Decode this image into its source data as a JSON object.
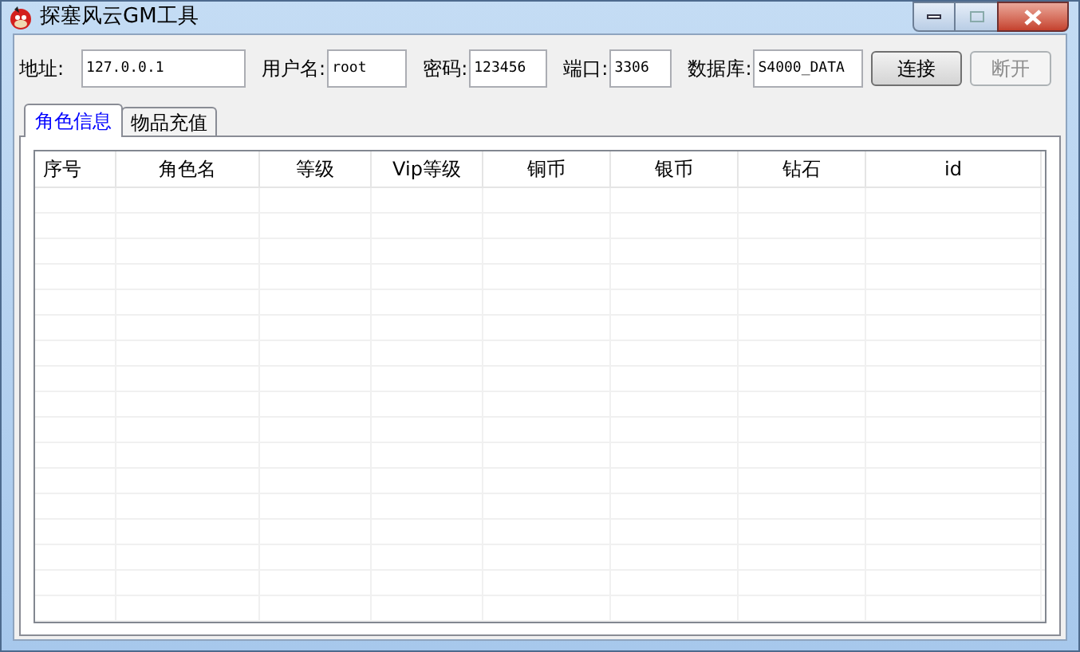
{
  "window": {
    "title": "探塞风云GM工具"
  },
  "connection": {
    "fields": [
      {
        "label": "地址:",
        "value": "127.0.0.1"
      },
      {
        "label": "用户名:",
        "value": "root"
      },
      {
        "label": "密码:",
        "value": "123456"
      },
      {
        "label": "端口:",
        "value": "3306"
      },
      {
        "label": "数据库:",
        "value": "S4000_DATA"
      }
    ],
    "buttons": [
      {
        "label": "连接",
        "disabled": false
      },
      {
        "label": "断开",
        "disabled": true
      }
    ]
  },
  "tabs": [
    {
      "label": "角色信息",
      "selected": true
    },
    {
      "label": "物品充值",
      "selected": false
    }
  ],
  "table": {
    "columns": [
      {
        "label": "序号"
      },
      {
        "label": "角色名"
      },
      {
        "label": "等级"
      },
      {
        "label": "Vip等级"
      },
      {
        "label": "铜币"
      },
      {
        "label": "银币"
      },
      {
        "label": "钻石"
      },
      {
        "label": "id"
      }
    ]
  }
}
